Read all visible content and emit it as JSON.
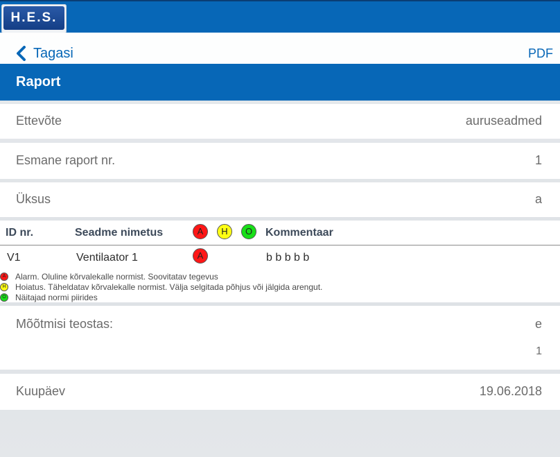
{
  "header": {
    "logo_text": "H.E.S."
  },
  "nav": {
    "back_label": "Tagasi",
    "pdf_label": "PDF"
  },
  "title": "Raport",
  "fields": {
    "company": {
      "label": "Ettevõte",
      "value": "auruseadmed"
    },
    "report_no": {
      "label": "Esmane raport nr.",
      "value": "1"
    },
    "unit": {
      "label": "Üksus",
      "value": "a"
    },
    "measured_by": {
      "label": "Mõõtmisi teostas:",
      "value": "e",
      "value2": "1"
    },
    "date": {
      "label": "Kuupäev",
      "value": "19.06.2018"
    }
  },
  "table": {
    "headers": {
      "id": "ID nr.",
      "name": "Seadme nimetus",
      "comment": "Kommentaar"
    },
    "status_letters": {
      "a": "A",
      "h": "H",
      "o": "O"
    },
    "rows": [
      {
        "id": "V1",
        "name": "Ventilaator 1",
        "status": "A",
        "comment": "b b b b b"
      }
    ]
  },
  "legend": [
    {
      "letter": "A",
      "text": "Alarm. Oluline kõrvalekalle normist. Soovitatav tegevus"
    },
    {
      "letter": "H",
      "text": "Hoiatus. Täheldatav kõrvalekalle normist. Välja selgitada põhjus või jälgida arengut."
    },
    {
      "letter": "O",
      "text": "Näitajad normi piirides"
    }
  ],
  "colors": {
    "primary": "#0767b7",
    "alarm": "#ff1616",
    "warning": "#ffff14",
    "ok": "#18e018"
  }
}
